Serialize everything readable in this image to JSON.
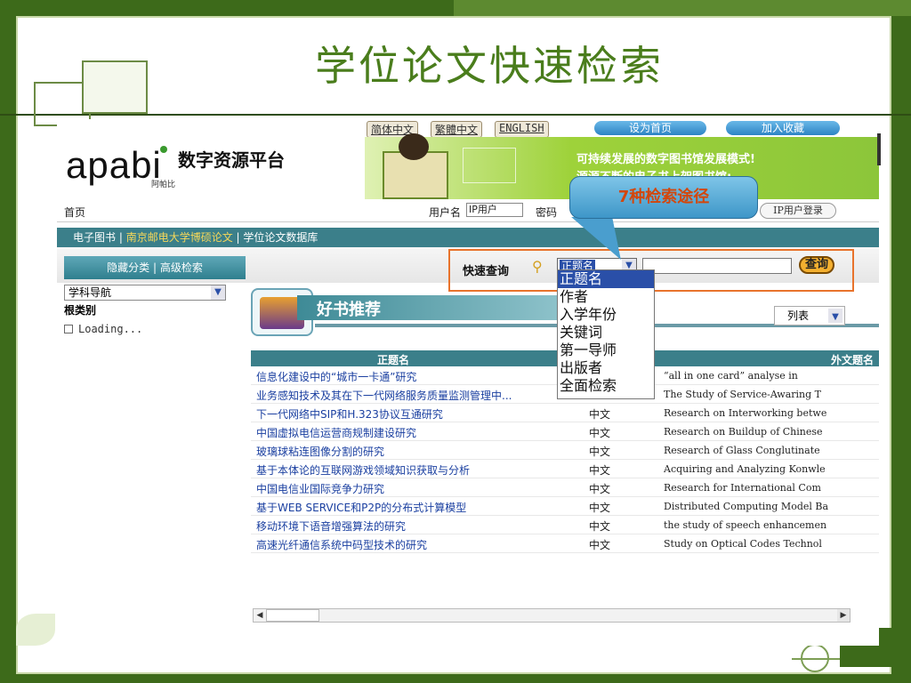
{
  "slide": {
    "title": "学位论文快速检索"
  },
  "header": {
    "lang_links": [
      "简体中文",
      "繁體中文",
      "ENGLISH"
    ],
    "set_home": "设为首页",
    "add_fav": "加入收藏",
    "logo": "apabi",
    "logo_sub": "阿帕比",
    "platform": "数字资源平台",
    "banner_line1": "可持续发展的数字图书馆发展模式!",
    "banner_line2": "源源不断的电子书上架图书馆;"
  },
  "nav": {
    "home": "首页",
    "user_label": "用户名",
    "user_value": "IP用户",
    "pwd_label": "密码",
    "ip_login": "IP用户登录"
  },
  "breadcrumb": {
    "prefix": "电子图书 | ",
    "highlight": "南京邮电大学博硕论文",
    "suffix": " | 学位论文数据库"
  },
  "toolbar": {
    "side_tab": "隐藏分类 | 高级检索",
    "quick_label": "快速查询",
    "field_value": "正题名",
    "search_btn": "查询"
  },
  "sidebar": {
    "nav_select": "学科导航",
    "root": "根类别",
    "loading": "Loading..."
  },
  "recommend": {
    "title": "好书推荐",
    "view_mode": "列表"
  },
  "callout": {
    "text": "7种检索途径"
  },
  "dropdown": {
    "options": [
      "正题名",
      "作者",
      "入学年份",
      "关键词",
      "第一导师",
      "出版者",
      "全面检索"
    ],
    "selected_index": 0
  },
  "table": {
    "headers": [
      "正题名",
      "外文题名"
    ],
    "rows": [
      {
        "title": "信息化建设中的“城市一卡通”研究",
        "lang": "",
        "en": "“all in one card” analyse in"
      },
      {
        "title": "业务感知技术及其在下一代网络服务质量监测管理中...",
        "lang": "",
        "en": "The Study of Service-Awaring T"
      },
      {
        "title": "下一代网络中SIP和H.323协议互通研究",
        "lang": "中文",
        "en": "Research on Interworking betwe"
      },
      {
        "title": "中国虚拟电信运营商规制建设研究",
        "lang": "中文",
        "en": "Research on Buildup of Chinese"
      },
      {
        "title": "玻璃球粘连图像分割的研究",
        "lang": "中文",
        "en": "Research of Glass Conglutinate"
      },
      {
        "title": "基于本体论的互联网游戏领域知识获取与分析",
        "lang": "中文",
        "en": "Acquiring and Analyzing Konwle"
      },
      {
        "title": "中国电信业国际竞争力研究",
        "lang": "中文",
        "en": "Research for International Com"
      },
      {
        "title": "基于WEB SERVICE和P2P的分布式计算模型",
        "lang": "中文",
        "en": "Distributed Computing Model Ba"
      },
      {
        "title": "移动环境下语音增强算法的研究",
        "lang": "中文",
        "en": "the study of speech enhancemen"
      },
      {
        "title": "高速光纤通信系统中码型技术的研究",
        "lang": "中文",
        "en": "Study on Optical Codes Technol"
      }
    ]
  },
  "colors": {
    "frame_green": "#3d6a1a",
    "title_green": "#4a7d1c",
    "teal_bar": "#3b7f8a",
    "highlight_orange": "#e8732c",
    "select_blue": "#2a4fa8"
  }
}
